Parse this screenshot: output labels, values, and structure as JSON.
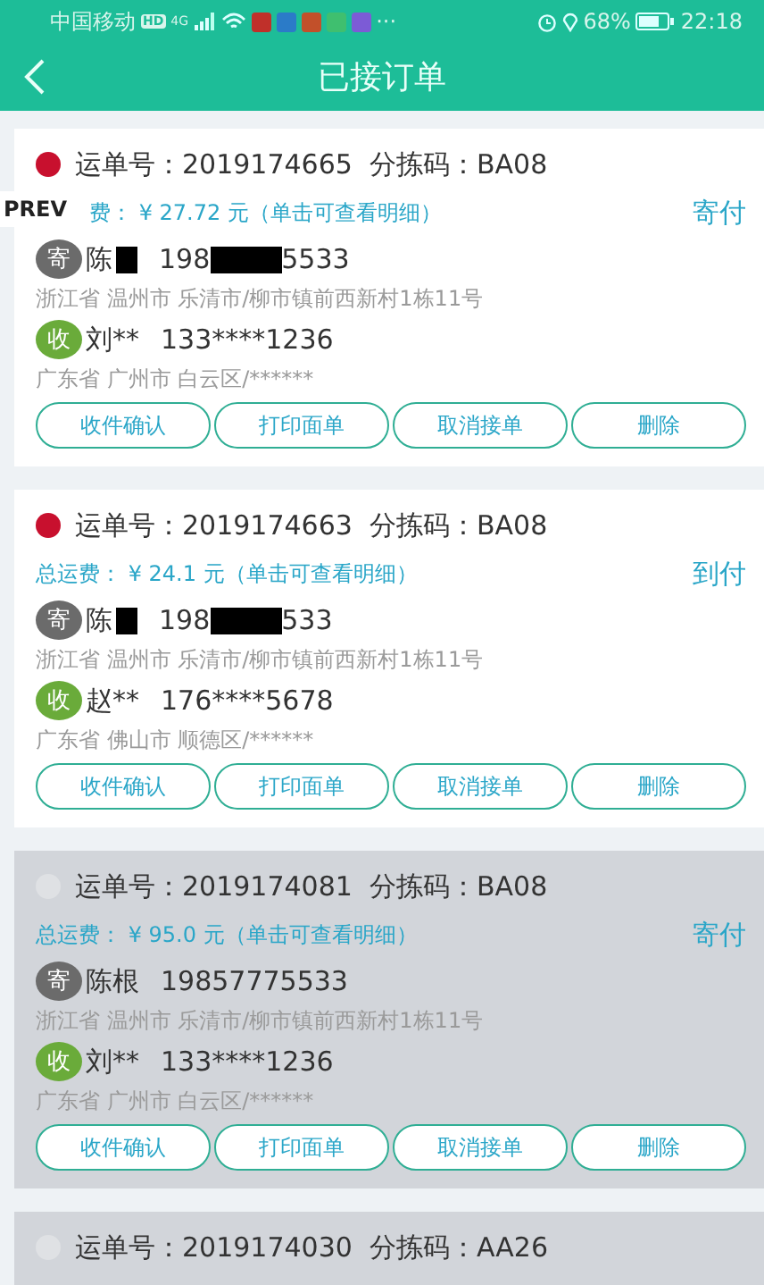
{
  "status_bar": {
    "carrier": "中国移动",
    "hd": "HD",
    "network": "4G",
    "more": "···",
    "battery": "68%",
    "time": "22:18"
  },
  "header": {
    "title": "已接订单"
  },
  "overlay": {
    "label": "PREV"
  },
  "orders": [
    {
      "flagged": true,
      "title": "运单号：2019174665  分拣码：BA08",
      "fee": "费： ¥ 27.72 元（单击可查看明细）",
      "fee_covered": true,
      "payment": "寄付",
      "sender": {
        "badge": "寄",
        "name": "陈",
        "name_redacted": true,
        "phone_parts": [
          "198",
          "5533"
        ],
        "address": "浙江省 温州市 乐清市/柳市镇前西新村1栋11号"
      },
      "recipient": {
        "badge": "收",
        "name": "刘**",
        "phone_parts": [
          "133****1236"
        ],
        "address": "广东省 广州市 白云区/******"
      },
      "buttons": [
        "收件确认",
        "打印面单",
        "取消接单",
        "删除"
      ]
    },
    {
      "flagged": true,
      "title": "运单号：2019174663  分拣码：BA08",
      "fee": "总运费： ¥ 24.1 元（单击可查看明细）",
      "payment": "到付",
      "sender": {
        "badge": "寄",
        "name": "陈",
        "name_redacted": true,
        "phone_parts": [
          "198",
          "533"
        ],
        "address": "浙江省 温州市 乐清市/柳市镇前西新村1栋11号"
      },
      "recipient": {
        "badge": "收",
        "name": "赵**",
        "phone_parts": [
          "176****5678"
        ],
        "address": "广东省 佛山市 顺德区/******"
      },
      "buttons": [
        "收件确认",
        "打印面单",
        "取消接单",
        "删除"
      ]
    },
    {
      "flagged": false,
      "title": "运单号：2019174081  分拣码：BA08",
      "fee": "总运费： ¥ 95.0 元（单击可查看明细）",
      "payment": "寄付",
      "sender": {
        "badge": "寄",
        "name": "陈根",
        "name_redacted": false,
        "phone_parts": [
          "19857775533"
        ],
        "address": "浙江省 温州市 乐清市/柳市镇前西新村1栋11号"
      },
      "recipient": {
        "badge": "收",
        "name": "刘**",
        "phone_parts": [
          "133****1236"
        ],
        "address": "广东省 广州市 白云区/******"
      },
      "buttons": [
        "收件确认",
        "打印面单",
        "取消接单",
        "删除"
      ]
    },
    {
      "flagged": false,
      "title": "运单号：2019174030  分拣码：AA26"
    }
  ]
}
